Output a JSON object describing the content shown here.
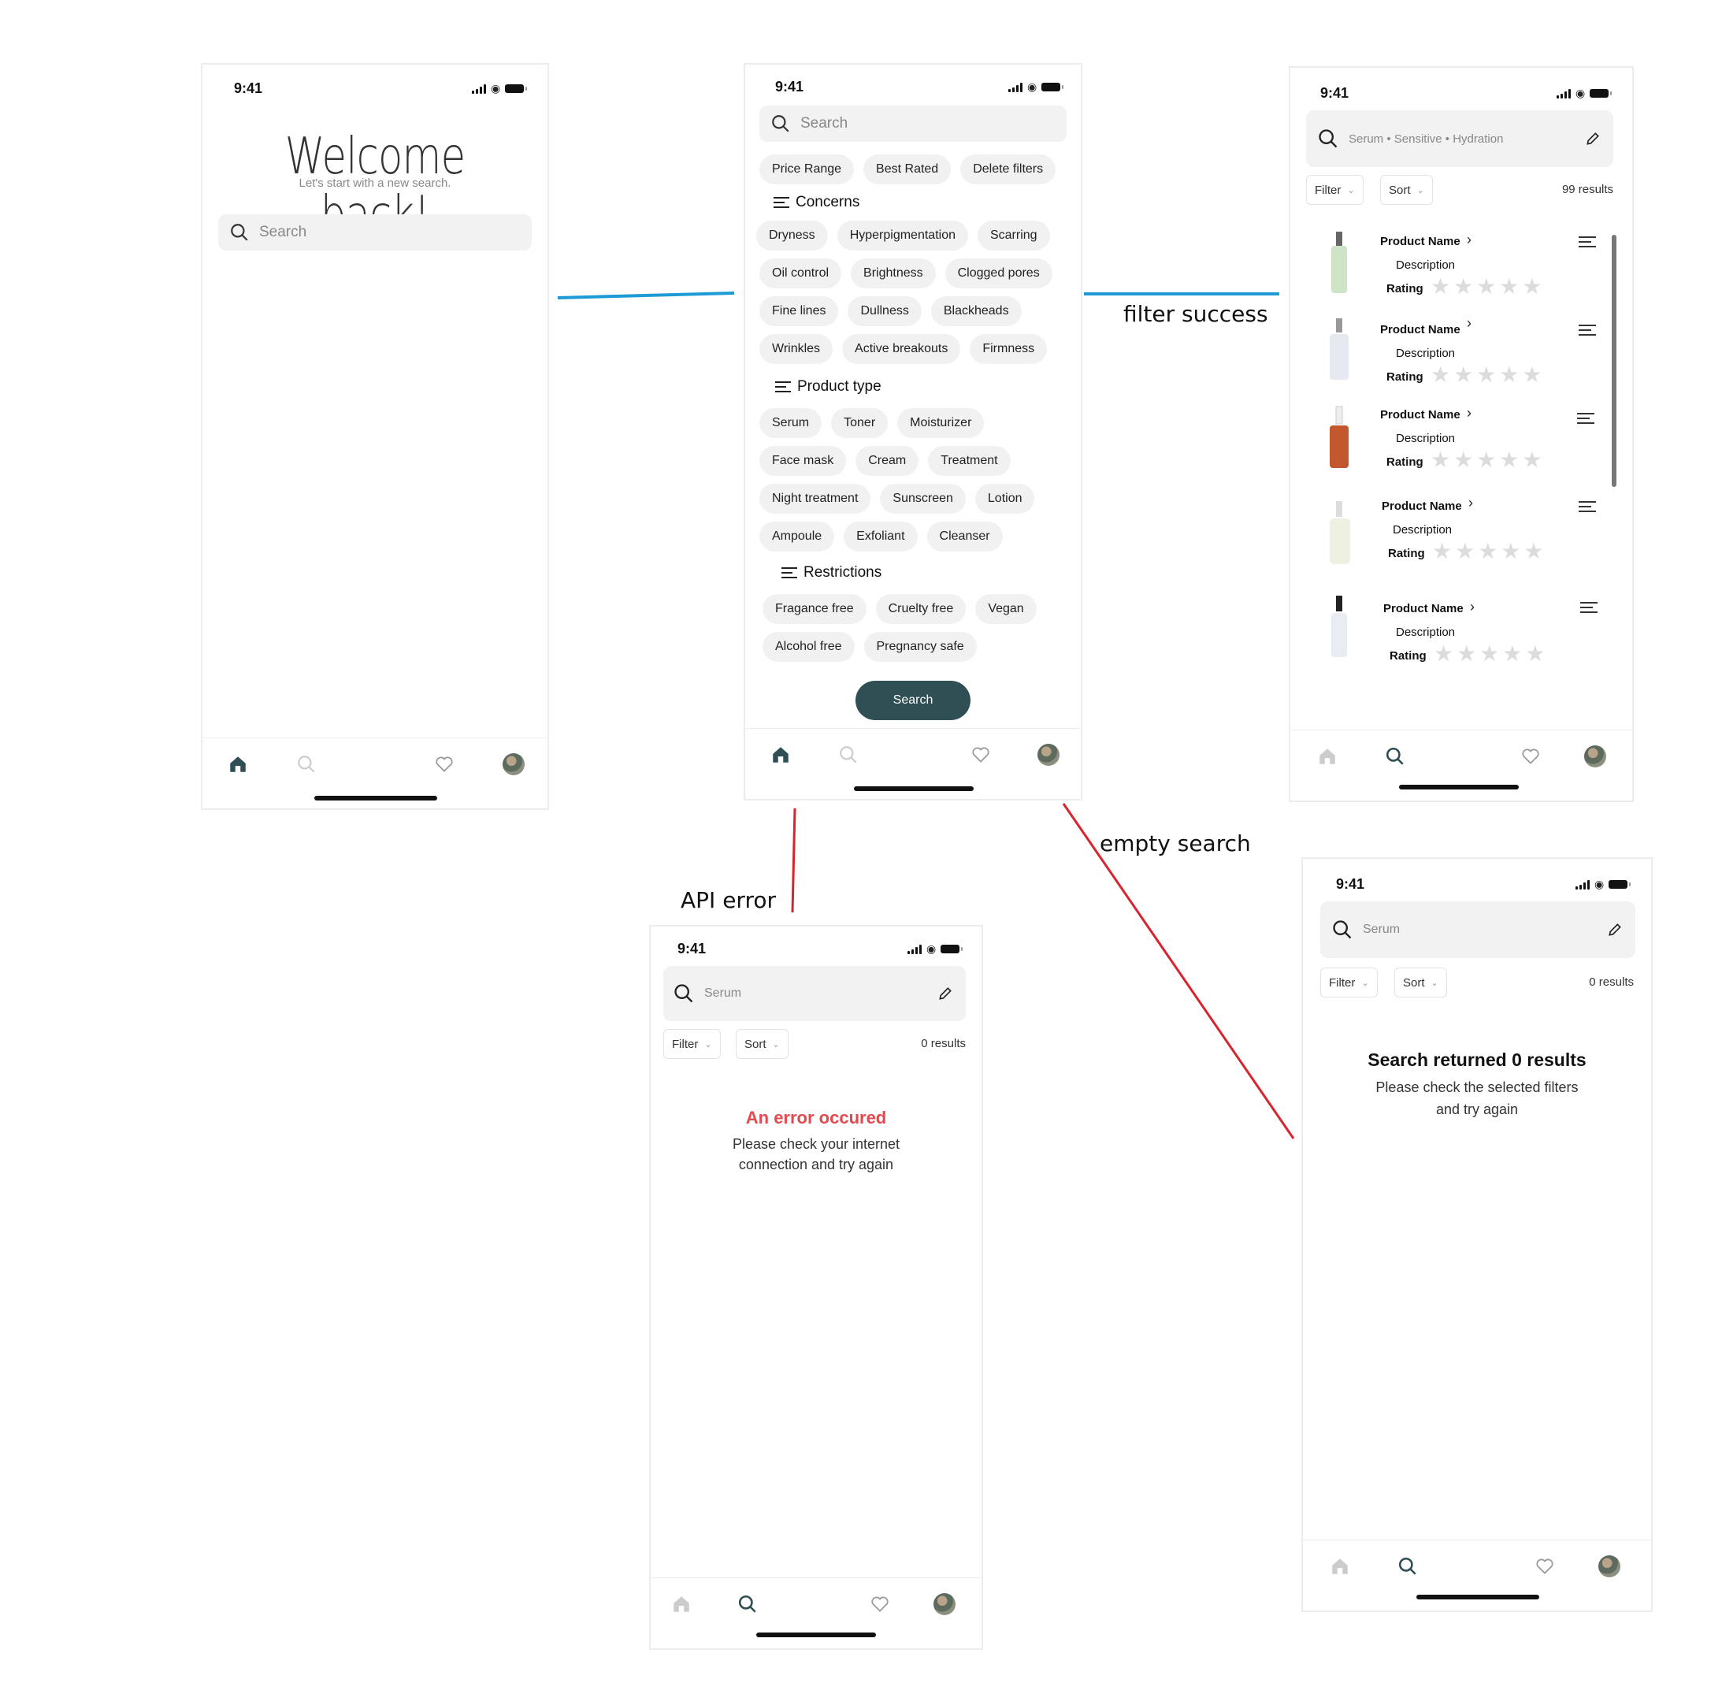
{
  "status_time": "9:41",
  "screen_welcome": {
    "title": "Welcome back!",
    "subtitle": "Let's start with a new search.",
    "search_placeholder": "Search"
  },
  "screen_filters": {
    "search_placeholder": "Search",
    "top_chips": [
      "Price Range",
      "Best Rated",
      "Delete filters"
    ],
    "concerns_label": "Concerns",
    "concerns": [
      [
        "Dryness",
        "Hyperpigmentation",
        "Scarring"
      ],
      [
        "Oil control",
        "Brightness",
        "Clogged pores"
      ],
      [
        "Fine lines",
        "Dullness",
        "Blackheads"
      ],
      [
        "Wrinkles",
        "Active breakouts",
        "Firmness"
      ]
    ],
    "product_type_label": "Product type",
    "product_types": [
      [
        "Serum",
        "Toner",
        "Moisturizer"
      ],
      [
        "Face mask",
        "Cream",
        "Treatment"
      ],
      [
        "Night treatment",
        "Sunscreen",
        "Lotion"
      ],
      [
        "Ampoule",
        "Exfoliant",
        "Cleanser"
      ]
    ],
    "restrictions_label": "Restrictions",
    "restrictions": [
      [
        "Fragance free",
        "Cruelty free",
        "Vegan"
      ],
      [
        "Alcohol free",
        "Pregnancy safe"
      ]
    ],
    "search_button": "Search"
  },
  "screen_results": {
    "query": "Serum • Sensitive • Hydration",
    "filter_label": "Filter",
    "sort_label": "Sort",
    "results_count": "99 results",
    "products": [
      {
        "name": "Product Name",
        "description": "Description",
        "rating_label": "Rating",
        "rating": 0,
        "bottle_color": "#cfe3c6"
      },
      {
        "name": "Product Name",
        "description": "Description",
        "rating_label": "Rating",
        "rating": 0,
        "bottle_color": "#e6eaf0"
      },
      {
        "name": "Product Name",
        "description": "Description",
        "rating_label": "Rating",
        "rating": 0,
        "bottle_color": "#c2562c"
      },
      {
        "name": "Product Name",
        "description": "Description",
        "rating_label": "Rating",
        "rating": 0,
        "bottle_color": "#eef0e2"
      },
      {
        "name": "Product Name",
        "description": "Description",
        "rating_label": "Rating",
        "rating": 0,
        "bottle_color": "#e9edf3"
      }
    ]
  },
  "screen_error": {
    "query": "Serum",
    "filter_label": "Filter",
    "sort_label": "Sort",
    "results_count": "0 results",
    "error_title": "An error occured",
    "error_body_1": "Please check your internet",
    "error_body_2": "connection and try again"
  },
  "screen_empty": {
    "query": "Serum",
    "filter_label": "Filter",
    "sort_label": "Sort",
    "results_count": "0 results",
    "empty_title": "Search returned 0 results",
    "empty_body_1": "Please check the selected filters",
    "empty_body_2": "and try again"
  },
  "annotations": {
    "filter_success": "filter success",
    "api_error": "API error",
    "empty_search": "empty search"
  },
  "colors": {
    "accent": "#2f4f55",
    "flow_success": "#1e9bd7",
    "flow_error": "#d9232d",
    "error_text": "#e5484d",
    "star_empty": "#dcdcdc"
  }
}
